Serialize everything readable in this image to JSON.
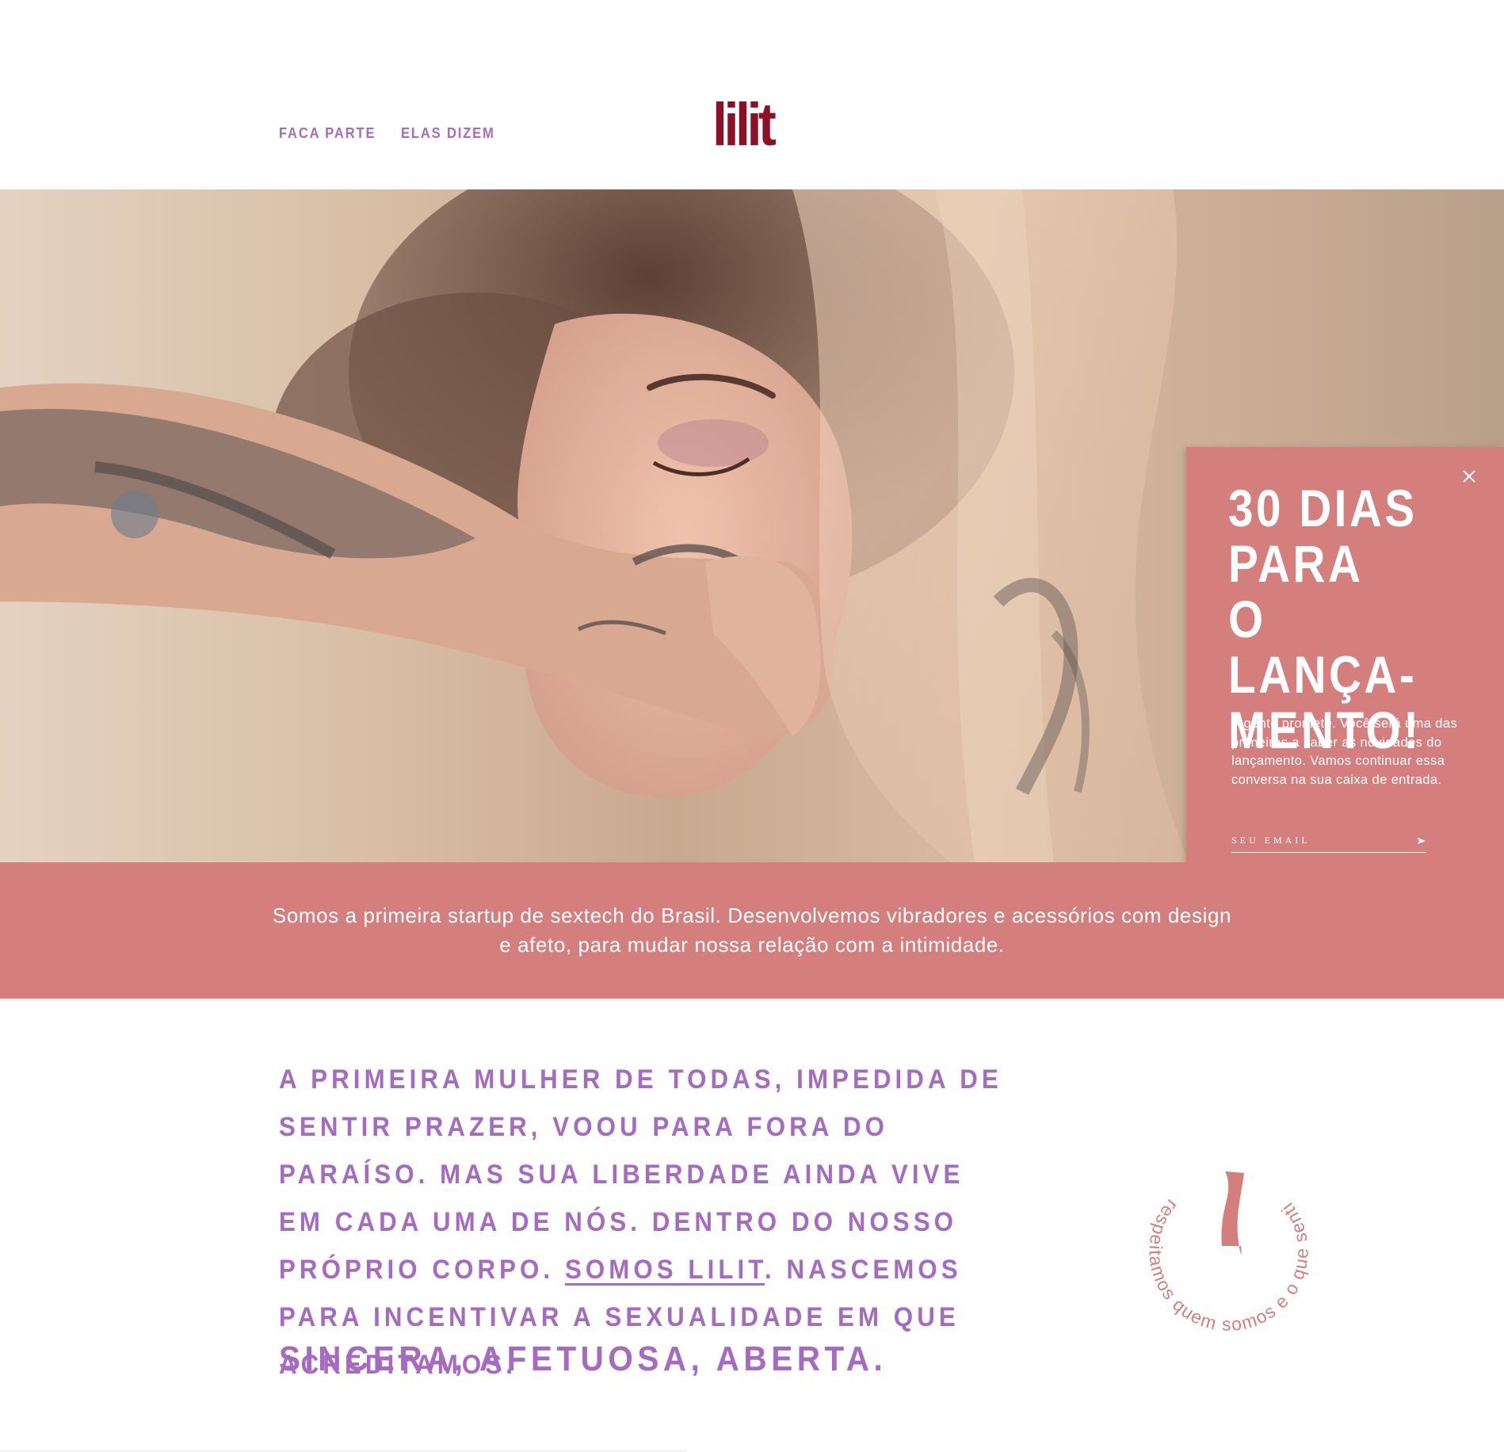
{
  "header": {
    "nav": [
      {
        "label": "FACA PARTE"
      },
      {
        "label": "ELAS DIZEM"
      }
    ],
    "logo": "lilit"
  },
  "popup": {
    "title": "30 DIAS\nPARA\nO LANÇA-\nMENTO!",
    "text": "A gente promete. Você será uma das primeiras a saber as novidades do lançamento. Vamos continuar essa conversa na sua caixa de entrada.",
    "email_placeholder": "SEU EMAIL",
    "icons": [
      "close-icon",
      "send-arrow-icon",
      "instagram-icon",
      "mail-icon"
    ]
  },
  "band": {
    "text": "Somos a primeira startup de sextech do Brasil. Desenvolvemos vibradores e acessórios com design e afeto, para mudar nossa relação com a intimidade."
  },
  "manifesto": {
    "part1": "A PRIMEIRA MULHER DE TODAS, IMPEDIDA DE SENTIR PRAZER, VOOU PARA FORA DO PARAÍSO. MAS SUA LIBERDADE AINDA VIVE EM CADA UMA DE NÓS. DENTRO DO NOSSO PRÓPRIO CORPO. ",
    "link": "SOMOS LILIT",
    "part2": ". NASCEMOS PARA INCENTIVAR A SEXUALIDADE EM QUE ACREDITAMOS.",
    "tagline": "SINCERA, AFETUOSA, ABERTA."
  },
  "badge": {
    "circle_text": "respeitamos quem somos e o que sentimos"
  },
  "colors": {
    "accent_purple": "#a46bc0",
    "logo_red": "#8c1028",
    "pink": "#d47f7e",
    "white": "#ffffff"
  }
}
